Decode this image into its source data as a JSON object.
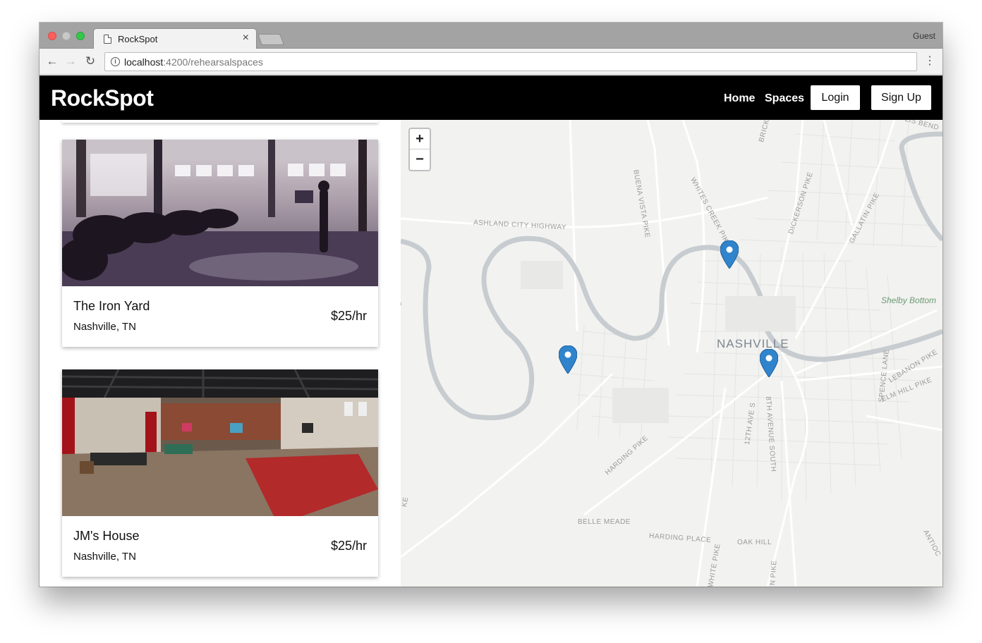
{
  "browser": {
    "tab_title": "RockSpot",
    "tab_close": "×",
    "profile": "Guest",
    "url_host": "localhost",
    "url_rest": ":4200/rehearsalspaces",
    "back_glyph": "←",
    "forward_glyph": "→",
    "reload_glyph": "↻",
    "menu_glyph": "⋮",
    "info_glyph": "i"
  },
  "navbar": {
    "brand": "RockSpot",
    "links": [
      "Home",
      "Spaces"
    ],
    "login_label": "Login",
    "signup_label": "Sign Up"
  },
  "listings": [
    {
      "name": "The Iron Yard",
      "location": "Nashville, TN",
      "price": "$25/hr"
    },
    {
      "name": "JM's House",
      "location": "Nashville, TN",
      "price": "$25/hr"
    }
  ],
  "map": {
    "zoom_in": "+",
    "zoom_out": "−",
    "city": "NASHVILLE",
    "park": "Shelby Bottom",
    "labels": {
      "ashland": "ASHLAND CITY HIGHWAY",
      "buena": "BUENA VISTA PIKE",
      "whites": "WHITES CREEK PIKE",
      "dickerson": "DICKERSON PIKE",
      "gallatin": "GALLATIN PIKE",
      "brick": "BRICK",
      "bend": "LIS BEND",
      "harding_pike": "HARDING PIKE",
      "twelfth": "12TH AVE S",
      "eighth": "8TH AVENUE SOUTH",
      "belle_meade": "BELLE MEADE",
      "harding_place": "HARDING PLACE",
      "oak_hill": "OAK HILL",
      "lebanon": "LEBANON PIKE",
      "elm_hill": "ELM HILL PIKE",
      "spence": "SPENCE LANE",
      "antioch": "ANTIOC",
      "white_pike": "WHITE PIKE",
      "n_pike": "N PIKE",
      "ke_top": "KE",
      "ke_bottom": "KE"
    },
    "marker_color": "#2f84cc",
    "marker_count": 3
  }
}
